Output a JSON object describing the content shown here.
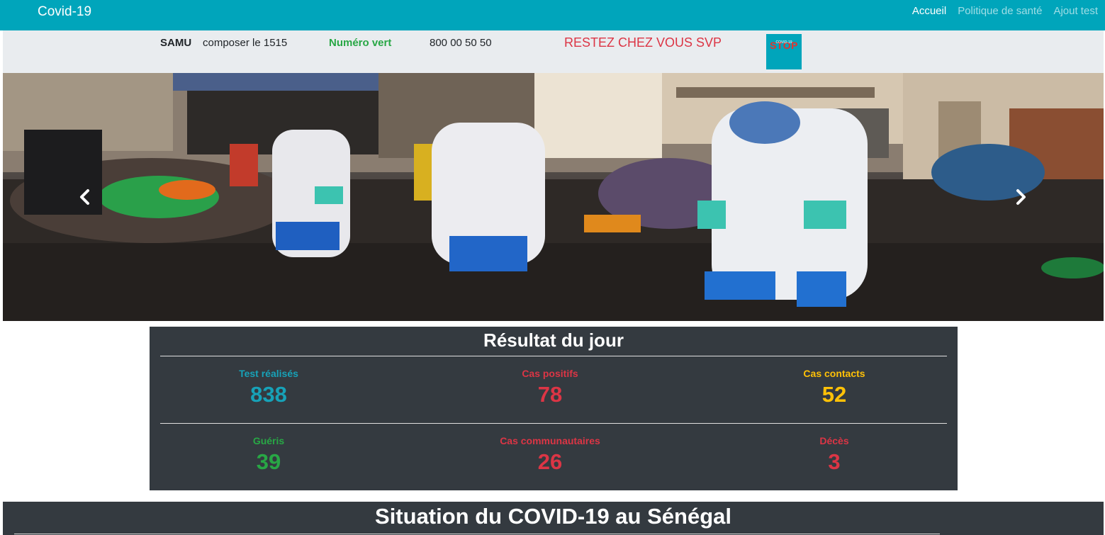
{
  "navbar": {
    "brand": "Covid-19",
    "links": [
      "Accueil",
      "Politique de santé",
      "Ajout test"
    ]
  },
  "info_bar": {
    "samu_label": "SAMU",
    "samu_text": "composer le 1515",
    "vert_label": "Numéro vert",
    "vert_number": "800 00 50 50",
    "stay_home": "RESTEZ CHEZ VOUS SVP",
    "logo_word": "STOP",
    "logo_sub": "COVID-19"
  },
  "carousel": {
    "image_icon": "photo-disinfection-team",
    "prev_icon": "chevron-left-icon",
    "next_icon": "chevron-right-icon"
  },
  "results": {
    "title": "Résultat du jour",
    "stats": [
      {
        "label": "Test réalisés",
        "value": "838",
        "color": "#17a2b8"
      },
      {
        "label": "Cas positifs",
        "value": "78",
        "color": "#dc3545"
      },
      {
        "label": "Cas contacts",
        "value": "52",
        "color": "#ffc107"
      },
      {
        "label": "Guéris",
        "value": "39",
        "color": "#28a745"
      },
      {
        "label": "Cas communautaires",
        "value": "26",
        "color": "#dc3545"
      },
      {
        "label": "Décès",
        "value": "3",
        "color": "#dc3545"
      }
    ]
  },
  "situation": {
    "title": "Situation du COVID-19 au Sénégal"
  },
  "colors": {
    "navbar": "#00a5bb",
    "dark_panel": "#343a40",
    "info_bar": "#e9ecef"
  }
}
